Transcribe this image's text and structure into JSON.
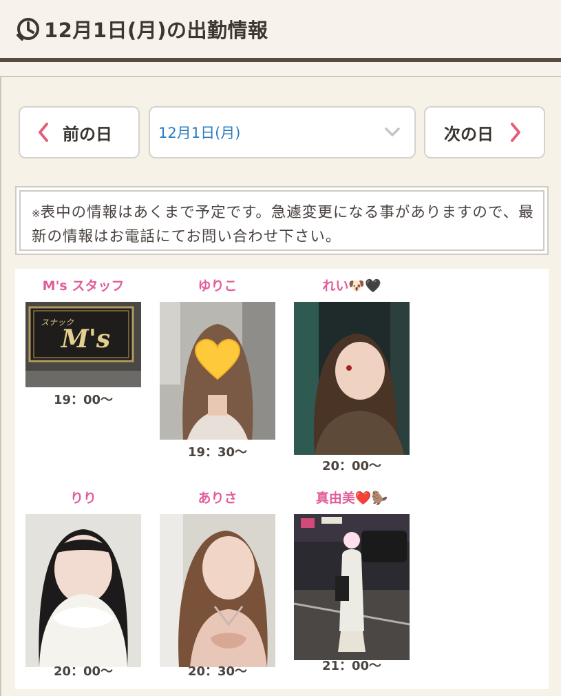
{
  "header": {
    "title": "12月1日(月)の出勤情報",
    "icon": "clock-icon"
  },
  "nav": {
    "prev_label": "前の日",
    "next_label": "次の日",
    "date_value": "12月1日(月)",
    "prev_icon": "chevron-left-icon",
    "next_icon": "chevron-right-icon",
    "dropdown_icon": "chevron-down-icon"
  },
  "notice": {
    "mark": "※",
    "text": "表中の情報はあくまで予定です。急遽変更になる事がありますので、最新の情報はお電話にてお問い合わせ下さい。"
  },
  "colors": {
    "accent": "#e25c9a",
    "link": "#2a7cc2",
    "chevron": "#e0607a",
    "rule": "#5b4a3f"
  },
  "staff": [
    {
      "name": "M's スタッフ",
      "time": "19：00〜",
      "photo": "store-sign-photo"
    },
    {
      "name": "ゆりこ",
      "time": "19：30〜",
      "photo": "girl-photo-heart-cover"
    },
    {
      "name": "れい🐶🖤",
      "time": "20：00〜",
      "photo": "girl-photo"
    },
    {
      "name": "りり",
      "time": "20：00〜",
      "photo": "girl-photo"
    },
    {
      "name": "ありさ",
      "time": "20：30〜",
      "photo": "girl-photo"
    },
    {
      "name": "真由美❤️🦫",
      "time": "21：00〜",
      "photo": "girl-photo-street"
    }
  ]
}
